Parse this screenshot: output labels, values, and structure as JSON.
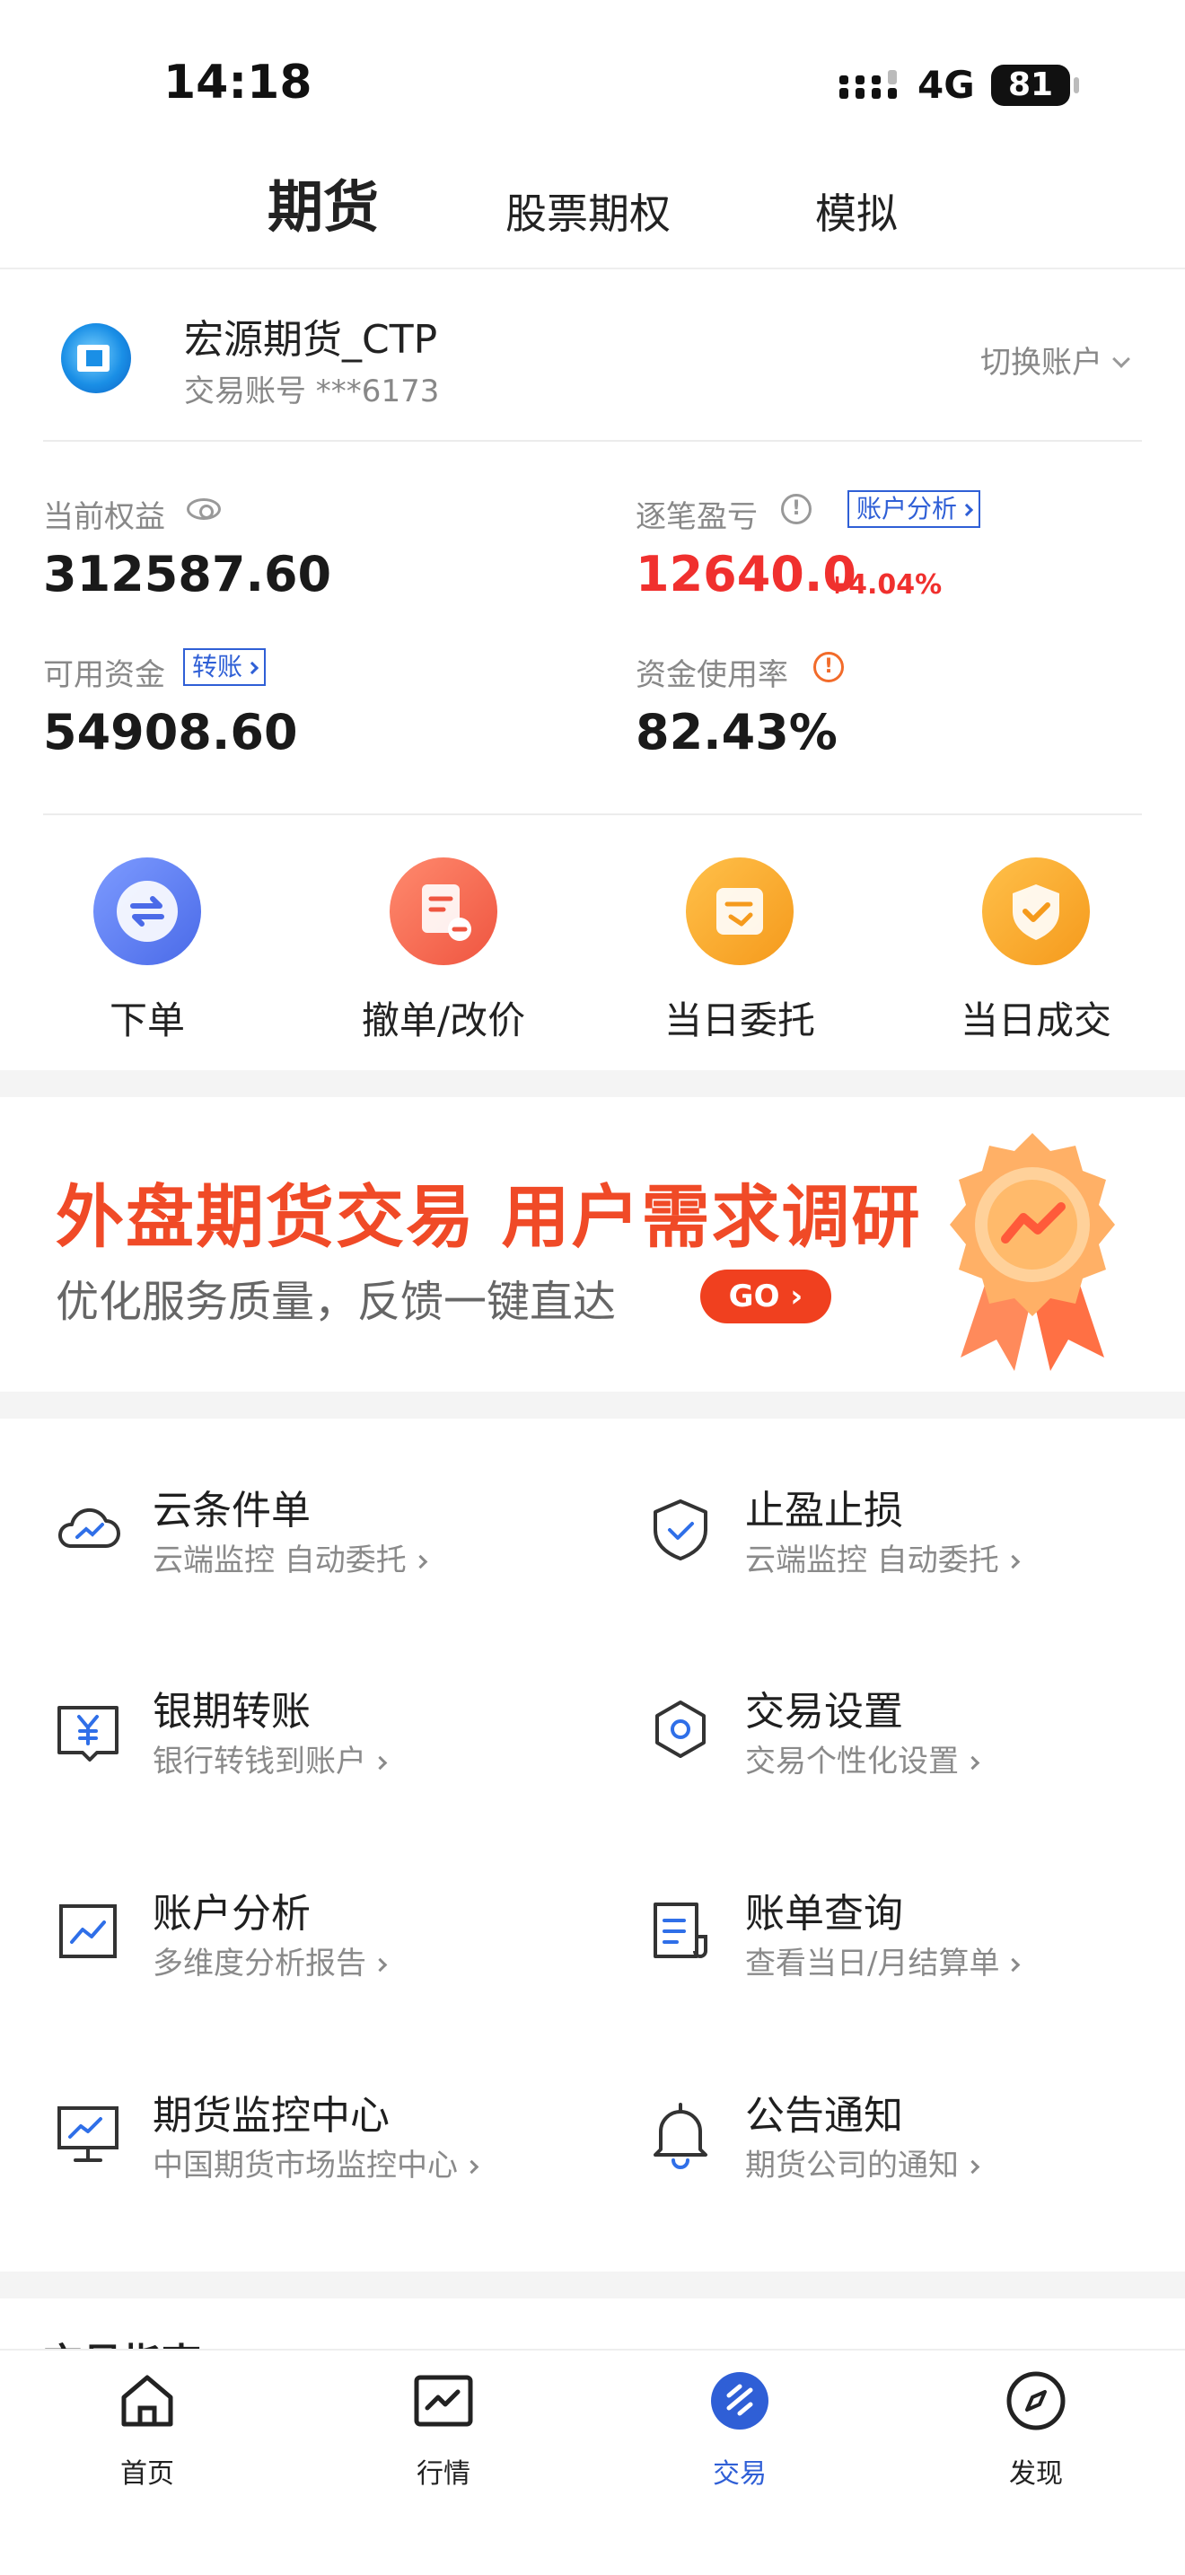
{
  "status": {
    "time": "14:18",
    "network": "4G",
    "battery": "81"
  },
  "top_tabs": [
    {
      "label": "期货",
      "active": true
    },
    {
      "label": "股票期权",
      "active": false
    },
    {
      "label": "模拟",
      "active": false
    }
  ],
  "account": {
    "name": "宏源期货_CTP",
    "number": "交易账号 ***6173",
    "switch_label": "切换账户"
  },
  "metrics": {
    "equity_label": "当前权益",
    "equity_value": "312587.60",
    "pnl_label": "逐笔盈亏",
    "pnl_value": "12640.0",
    "pnl_pct": "+4.04%",
    "analysis_chip": "账户分析",
    "available_label": "可用资金",
    "transfer_chip": "转账",
    "available_value": "54908.60",
    "usage_label": "资金使用率",
    "usage_value": "82.43%"
  },
  "quick_actions": [
    {
      "label": "下单",
      "icon": "swap-arrows-icon",
      "color": "#5b7ff0"
    },
    {
      "label": "撤单/改价",
      "icon": "cancel-order-icon",
      "color": "#f2684f"
    },
    {
      "label": "当日委托",
      "icon": "entrust-icon",
      "color": "#f6a323"
    },
    {
      "label": "当日成交",
      "icon": "deal-shield-icon",
      "color": "#f6a323"
    }
  ],
  "banner": {
    "title": "外盘期货交易 用户需求调研",
    "subtitle": "优化服务质量，反馈一键直达",
    "go_label": "GO"
  },
  "tools": [
    {
      "title": "云条件单",
      "subtitle": "云端监控 自动委托",
      "icon": "cloud-chart-icon"
    },
    {
      "title": "止盈止损",
      "subtitle": "云端监控 自动委托",
      "icon": "shield-check-icon"
    },
    {
      "title": "银期转账",
      "subtitle": "银行转钱到账户",
      "icon": "yuan-transfer-icon"
    },
    {
      "title": "交易设置",
      "subtitle": "交易个性化设置",
      "icon": "hexagon-settings-icon"
    },
    {
      "title": "账户分析",
      "subtitle": "多维度分析报告",
      "icon": "line-chart-icon"
    },
    {
      "title": "账单查询",
      "subtitle": "查看当日/月结算单",
      "icon": "bill-icon"
    },
    {
      "title": "期货监控中心",
      "subtitle": "中国期货市场监控中心",
      "icon": "monitor-chart-icon"
    },
    {
      "title": "公告通知",
      "subtitle": "期货公司的通知",
      "icon": "bell-icon"
    }
  ],
  "section_title": "交易指南",
  "bottom_nav": [
    {
      "label": "首页",
      "icon": "home-icon"
    },
    {
      "label": "行情",
      "icon": "market-chart-icon"
    },
    {
      "label": "交易",
      "icon": "trade-icon",
      "active": true
    },
    {
      "label": "发现",
      "icon": "compass-icon"
    }
  ],
  "colors": {
    "accent": "#2f5fd6",
    "up_red": "#f0302e",
    "banner_red": "#f04a27"
  }
}
